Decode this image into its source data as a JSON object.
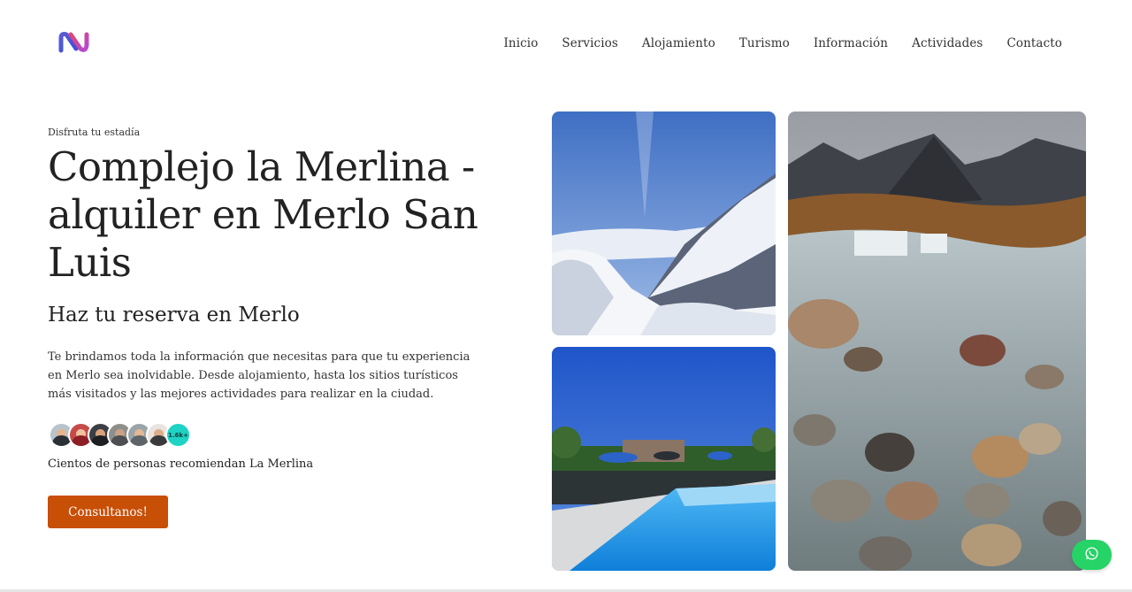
{
  "nav": {
    "items": [
      "Inicio",
      "Servicios",
      "Alojamiento",
      "Turismo",
      "Información",
      "Actividades",
      "Contacto"
    ]
  },
  "hero": {
    "eyebrow": "Disfruta tu estadía",
    "title": "Complejo la Merlina - alquiler en Merlo San Luis",
    "subtitle": "Haz tu reserva en Merlo",
    "description": "Te brindamos toda la información que necesitas para que tu experiencia en Merlo sea inolvidable. Desde alojamiento, hasta los sitios turísticos más visitados y las mejores actividades para realizar en la ciudad.",
    "avatar_count": "1.6k+",
    "recommend": "Cientos de personas recomiendan La Merlina",
    "cta": "Consultanos!"
  },
  "colors": {
    "accent": "#c84f06",
    "badge": "#1ed3c4",
    "whatsapp": "#25d366"
  },
  "icons": {
    "logo": "brand-logo-icon",
    "whatsapp": "whatsapp-icon"
  }
}
